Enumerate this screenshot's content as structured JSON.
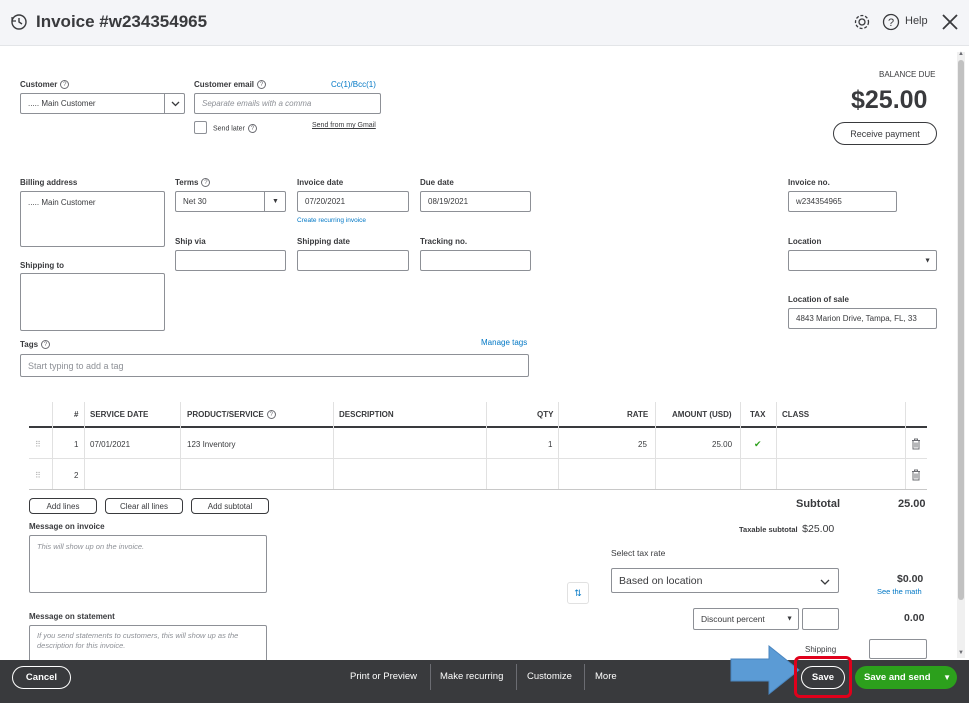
{
  "header": {
    "title": "Invoice #w234354965",
    "help_label": "Help"
  },
  "customer": {
    "label": "Customer",
    "value": "..... Main Customer",
    "email_label": "Customer email",
    "email_placeholder": "Separate emails with a comma",
    "cc_bcc": "Cc(1)/Bcc(1)",
    "send_later": "Send later",
    "send_from_gmail": "Send from my Gmail"
  },
  "balance": {
    "label": "BALANCE DUE",
    "amount": "$25.00",
    "receive_payment": "Receive payment"
  },
  "billing": {
    "billing_label": "Billing address",
    "billing_value": "..... Main Customer",
    "shipping_label": "Shipping to"
  },
  "terms": {
    "label": "Terms",
    "value": "Net 30",
    "ship_via_label": "Ship via"
  },
  "dates": {
    "invoice_date_label": "Invoice date",
    "invoice_date": "07/20/2021",
    "create_recurring": "Create recurring invoice",
    "due_date_label": "Due date",
    "due_date": "08/19/2021",
    "shipping_date_label": "Shipping date",
    "tracking_label": "Tracking no."
  },
  "invoice_meta": {
    "invoice_no_label": "Invoice no.",
    "invoice_no": "w234354965",
    "location_label": "Location",
    "location_of_sale_label": "Location of sale",
    "location_of_sale": "4843  Marion Drive, Tampa, FL, 33"
  },
  "tags": {
    "label": "Tags",
    "manage": "Manage tags",
    "placeholder": "Start typing to add a tag"
  },
  "table": {
    "headers": [
      "#",
      "SERVICE DATE",
      "PRODUCT/SERVICE",
      "DESCRIPTION",
      "QTY",
      "RATE",
      "AMOUNT (USD)",
      "TAX",
      "CLASS"
    ],
    "rows": [
      {
        "num": "1",
        "service_date": "07/01/2021",
        "product": "123 Inventory",
        "description": "",
        "qty": "1",
        "rate": "25",
        "amount": "25.00",
        "tax": "✔",
        "class": ""
      },
      {
        "num": "2",
        "service_date": "",
        "product": "",
        "description": "",
        "qty": "",
        "rate": "",
        "amount": "",
        "tax": "",
        "class": ""
      }
    ],
    "add_lines": "Add lines",
    "clear_all_lines": "Clear all lines",
    "add_subtotal": "Add subtotal"
  },
  "messages": {
    "invoice_label": "Message on invoice",
    "invoice_placeholder": "This will show up on the invoice.",
    "statement_label": "Message on statement",
    "statement_placeholder": "If you send statements to customers, this will show up as the description for this invoice."
  },
  "totals": {
    "subtotal_label": "Subtotal",
    "subtotal_value": "25.00",
    "taxable_subtotal_label": "Taxable subtotal",
    "taxable_subtotal_value": "$25.00",
    "select_tax_rate": "Select tax rate",
    "tax_rate_value": "Based on location",
    "tax_amount": "$0.00",
    "see_the_math": "See the math",
    "discount_label": "Discount percent",
    "discount_value": "0.00",
    "shipping_label": "Shipping"
  },
  "footer": {
    "cancel": "Cancel",
    "print_preview": "Print or Preview",
    "make_recurring": "Make recurring",
    "customize": "Customize",
    "more": "More",
    "save": "Save",
    "save_and_send": "Save and send"
  },
  "colors": {
    "accent_blue": "#0077c5",
    "save_green": "#2ca01c",
    "footer_bg": "#393a3d",
    "highlight_red": "#e0001b",
    "arrow_blue": "#5b9bd5"
  }
}
